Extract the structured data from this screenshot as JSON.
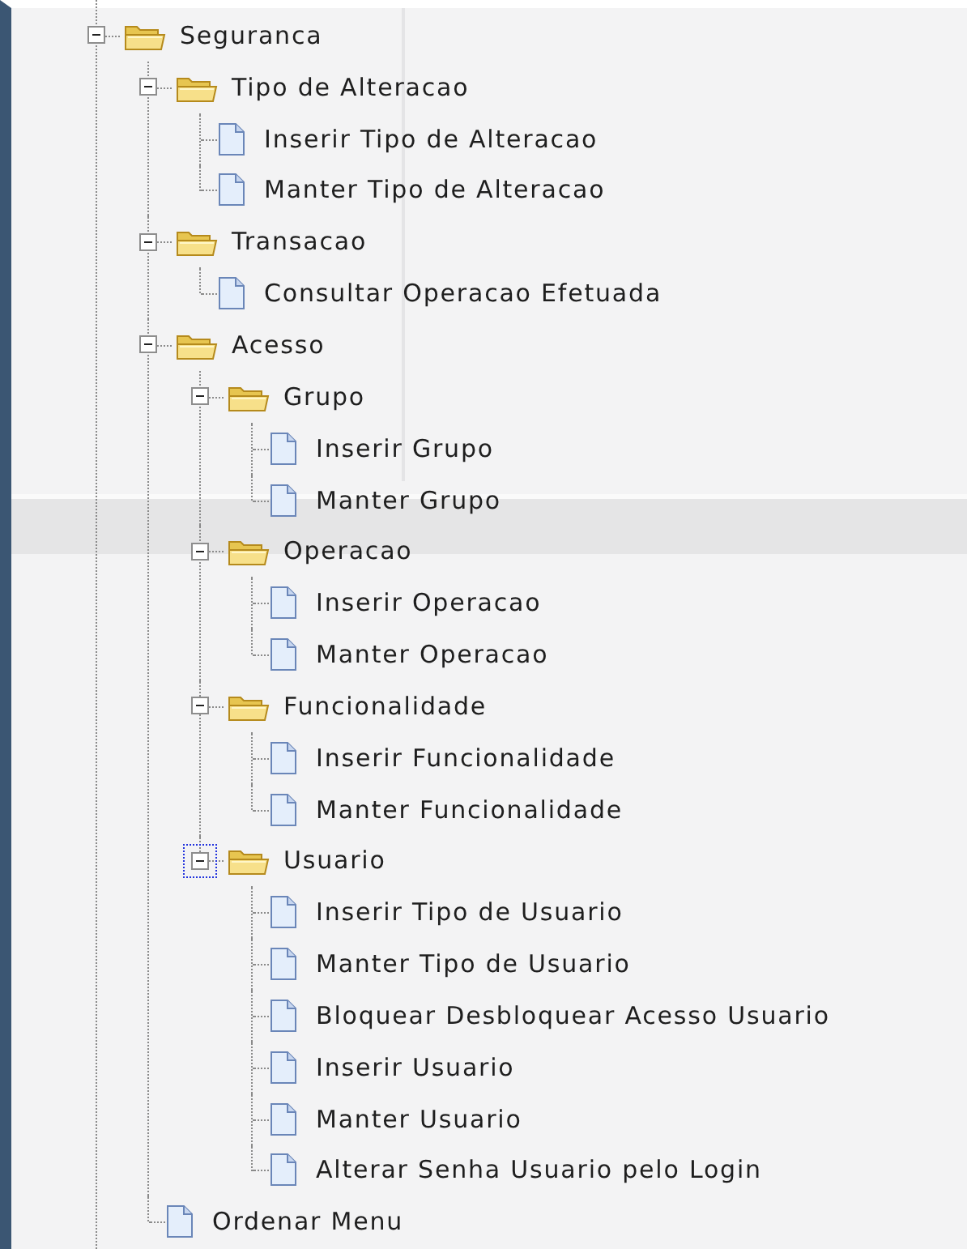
{
  "tree": [
    {
      "kind": "folder",
      "label": "Seguranca",
      "expanded": true,
      "focused": false,
      "children": [
        {
          "kind": "folder",
          "label": "Tipo de Alteracao",
          "expanded": true,
          "focused": false,
          "children": [
            {
              "kind": "leaf",
              "label": "Inserir Tipo de Alteracao"
            },
            {
              "kind": "leaf",
              "label": "Manter Tipo de Alteracao"
            }
          ]
        },
        {
          "kind": "folder",
          "label": "Transacao",
          "expanded": true,
          "focused": false,
          "children": [
            {
              "kind": "leaf",
              "label": "Consultar Operacao Efetuada"
            }
          ]
        },
        {
          "kind": "folder",
          "label": "Acesso",
          "expanded": true,
          "focused": false,
          "children": [
            {
              "kind": "folder",
              "label": "Grupo",
              "expanded": true,
              "focused": false,
              "children": [
                {
                  "kind": "leaf",
                  "label": "Inserir Grupo"
                },
                {
                  "kind": "leaf",
                  "label": "Manter Grupo"
                }
              ]
            },
            {
              "kind": "folder",
              "label": "Operacao",
              "expanded": true,
              "focused": false,
              "children": [
                {
                  "kind": "leaf",
                  "label": "Inserir Operacao"
                },
                {
                  "kind": "leaf",
                  "label": "Manter Operacao"
                }
              ]
            },
            {
              "kind": "folder",
              "label": "Funcionalidade",
              "expanded": true,
              "focused": false,
              "children": [
                {
                  "kind": "leaf",
                  "label": "Inserir Funcionalidade"
                },
                {
                  "kind": "leaf",
                  "label": "Manter Funcionalidade"
                }
              ]
            },
            {
              "kind": "folder",
              "label": "Usuario",
              "expanded": true,
              "focused": true,
              "children": [
                {
                  "kind": "leaf",
                  "label": "Inserir Tipo de Usuario"
                },
                {
                  "kind": "leaf",
                  "label": "Manter Tipo de Usuario"
                },
                {
                  "kind": "leaf",
                  "label": "Bloquear Desbloquear Acesso Usuario"
                },
                {
                  "kind": "leaf",
                  "label": "Inserir Usuario"
                },
                {
                  "kind": "leaf",
                  "label": "Manter Usuario"
                },
                {
                  "kind": "leaf",
                  "label": "Alterar Senha Usuario pelo Login"
                }
              ]
            }
          ]
        },
        {
          "kind": "leaf",
          "label": "Ordenar Menu"
        }
      ]
    }
  ]
}
